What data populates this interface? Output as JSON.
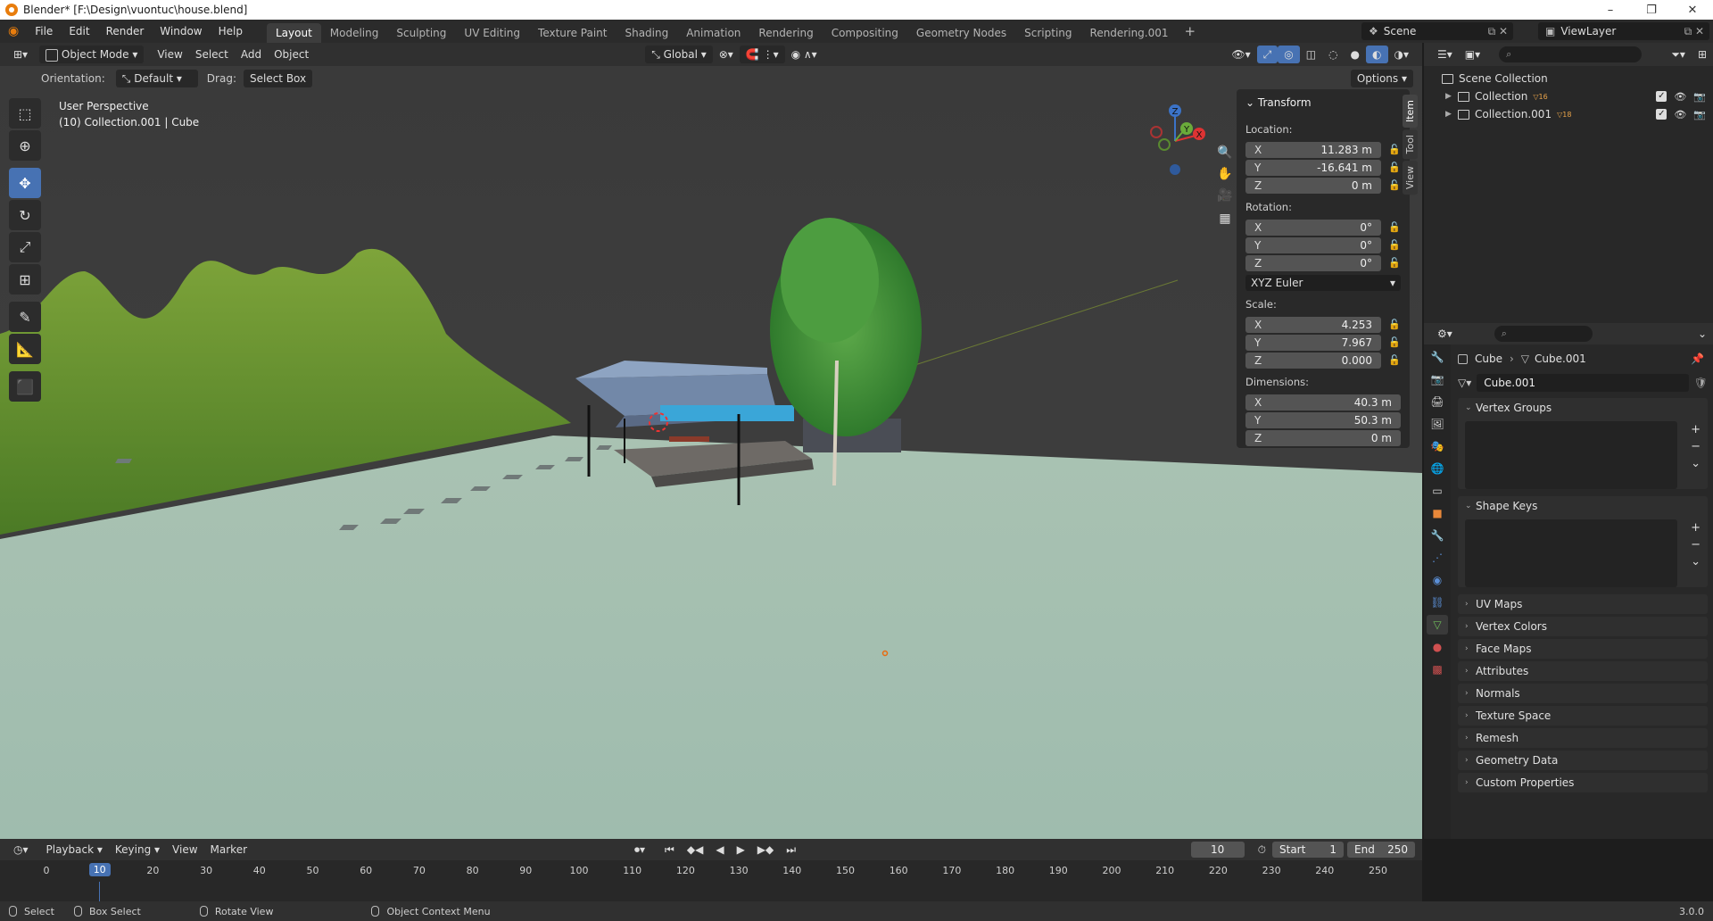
{
  "window": {
    "title": "Blender* [F:\\Design\\vuontuc\\house.blend]",
    "controls": [
      "–",
      "❐",
      "✕"
    ]
  },
  "menu": [
    "File",
    "Edit",
    "Render",
    "Window",
    "Help"
  ],
  "workspaces": [
    "Layout",
    "Modeling",
    "Sculpting",
    "UV Editing",
    "Texture Paint",
    "Shading",
    "Animation",
    "Rendering",
    "Compositing",
    "Geometry Nodes",
    "Scripting",
    "Rendering.001"
  ],
  "active_workspace": "Layout",
  "scene": "Scene",
  "view_layer": "ViewLayer",
  "viewport": {
    "mode": "Object Mode",
    "menus": [
      "View",
      "Select",
      "Add",
      "Object"
    ],
    "transform_orientation": "Global",
    "orientation_label": "Orientation:",
    "orientation_value": "Default",
    "drag_label": "Drag:",
    "drag_value": "Select Box",
    "options": "Options",
    "info_line1": "User Perspective",
    "info_line2": "(10) Collection.001 | Cube"
  },
  "gizmo_axes": [
    "Z",
    "Y",
    "X"
  ],
  "transform": {
    "header": "Transform",
    "location_label": "Location:",
    "location": [
      {
        "axis": "X",
        "value": "11.283 m"
      },
      {
        "axis": "Y",
        "value": "-16.641 m"
      },
      {
        "axis": "Z",
        "value": "0 m"
      }
    ],
    "rotation_label": "Rotation:",
    "rotation": [
      {
        "axis": "X",
        "value": "0°"
      },
      {
        "axis": "Y",
        "value": "0°"
      },
      {
        "axis": "Z",
        "value": "0°"
      }
    ],
    "rotation_mode": "XYZ Euler",
    "scale_label": "Scale:",
    "scale": [
      {
        "axis": "X",
        "value": "4.253"
      },
      {
        "axis": "Y",
        "value": "7.967"
      },
      {
        "axis": "Z",
        "value": "0.000"
      }
    ],
    "dimensions_label": "Dimensions:",
    "dimensions": [
      {
        "axis": "X",
        "value": "40.3 m"
      },
      {
        "axis": "Y",
        "value": "50.3 m"
      },
      {
        "axis": "Z",
        "value": "0 m"
      }
    ]
  },
  "npanel_tabs": [
    "Item",
    "Tool",
    "View"
  ],
  "outliner": {
    "root": "Scene Collection",
    "items": [
      {
        "name": "Collection",
        "count": "16"
      },
      {
        "name": "Collection.001",
        "count": "18"
      }
    ]
  },
  "properties": {
    "breadcrumb_object": "Cube",
    "breadcrumb_data": "Cube.001",
    "mesh_name": "Cube.001",
    "panels_open": [
      "Vertex Groups",
      "Shape Keys"
    ],
    "panels_closed": [
      "UV Maps",
      "Vertex Colors",
      "Face Maps",
      "Attributes",
      "Normals",
      "Texture Space",
      "Remesh",
      "Geometry Data",
      "Custom Properties"
    ]
  },
  "timeline": {
    "menus": [
      "Playback",
      "Keying",
      "View",
      "Marker"
    ],
    "current_frame": "10",
    "start_label": "Start",
    "start": "1",
    "end_label": "End",
    "end": "250",
    "ticks": [
      "0",
      "10",
      "20",
      "30",
      "40",
      "50",
      "60",
      "70",
      "80",
      "90",
      "100",
      "110",
      "120",
      "130",
      "140",
      "150",
      "160",
      "170",
      "180",
      "190",
      "200",
      "210",
      "220",
      "230",
      "240",
      "250"
    ]
  },
  "statusbar": {
    "items": [
      "Select",
      "Box Select",
      "Rotate View",
      "Object Context Menu"
    ],
    "version": "3.0.0"
  }
}
